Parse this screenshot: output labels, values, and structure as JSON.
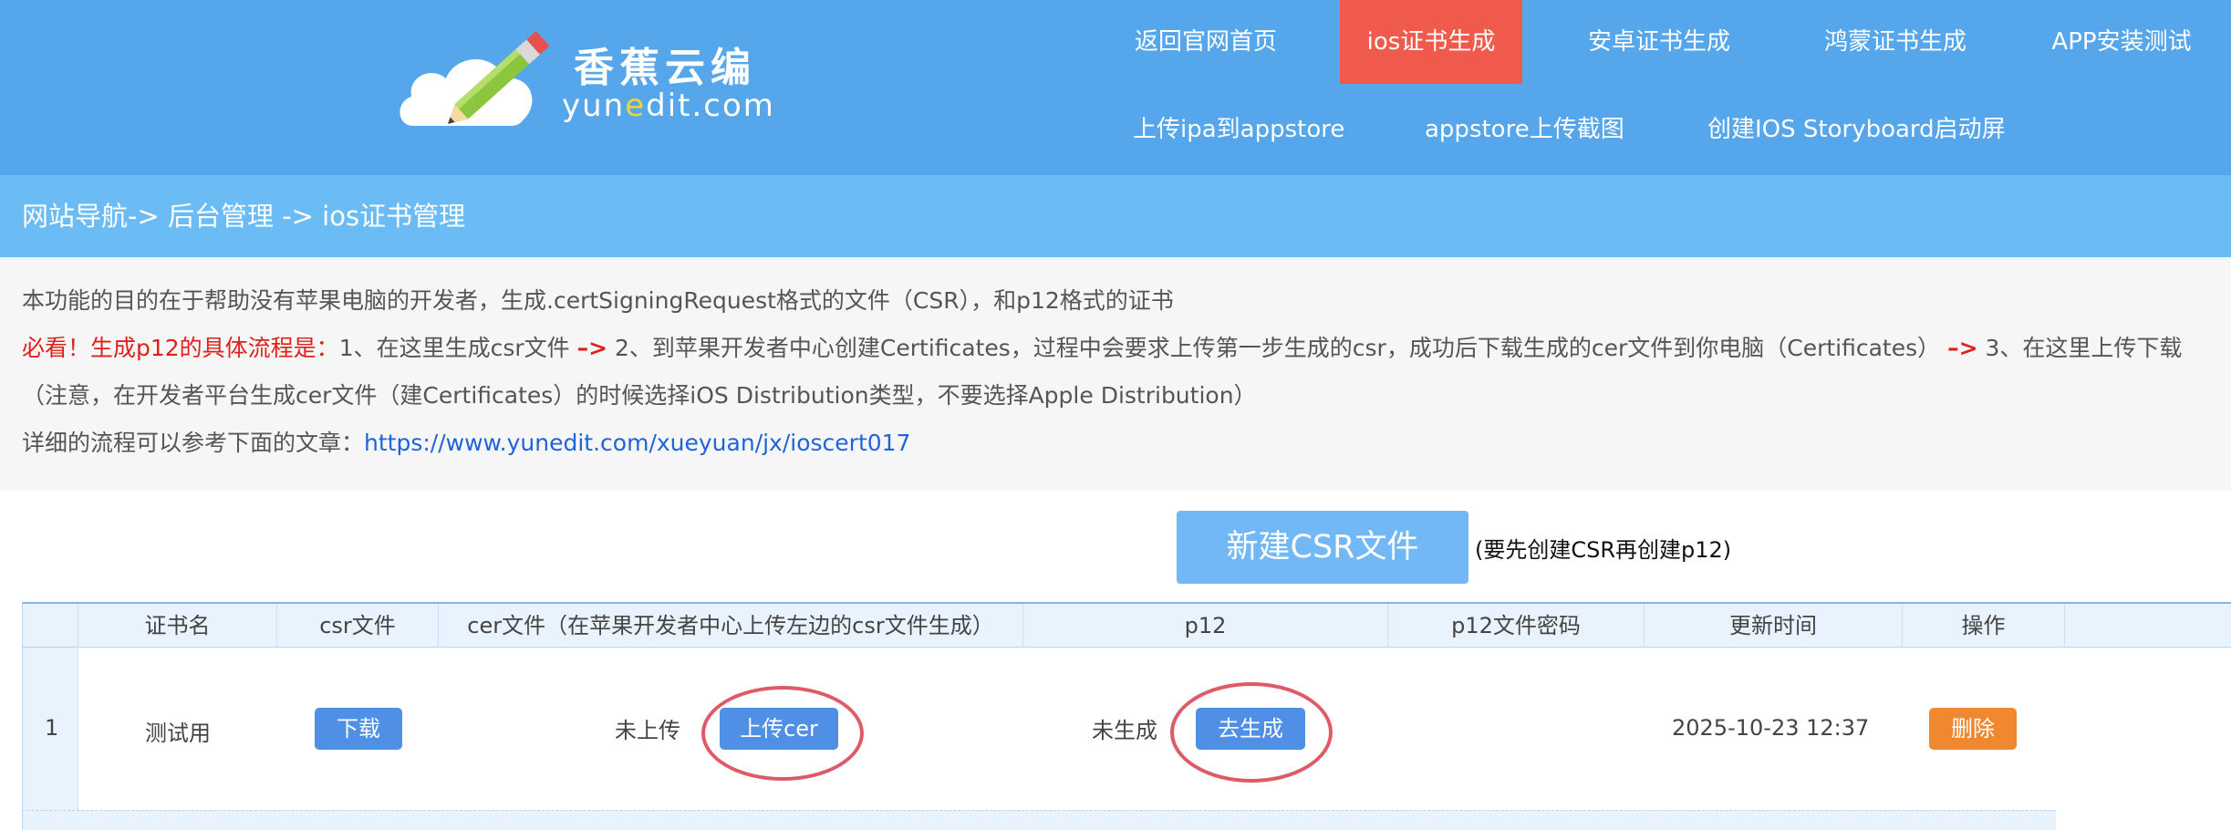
{
  "brand": {
    "name_cn": "香蕉云编",
    "name_en_pre": "yun",
    "name_en_e": "e",
    "name_en_post": "dit.com"
  },
  "nav": {
    "items": [
      {
        "label": "返回官网首页",
        "active": false
      },
      {
        "label": "ios证书生成",
        "active": true
      },
      {
        "label": "安卓证书生成",
        "active": false
      },
      {
        "label": "鸿蒙证书生成",
        "active": false
      },
      {
        "label": "APP安装测试",
        "active": false
      },
      {
        "label": "上传ipa到appstore",
        "active": false
      },
      {
        "label": "appstore上传截图",
        "active": false
      },
      {
        "label": "创建IOS Storyboard启动屏",
        "active": false
      }
    ]
  },
  "breadcrumb": "网站导航-> 后台管理 -> ios证书管理",
  "info": {
    "line1": "本功能的目的在于帮助没有苹果电脑的开发者，生成.certSigningRequest格式的文件（CSR），和p12格式的证书",
    "line2_red": "必看！生成p12的具体流程是：",
    "line2_step1": "1、在这里生成csr文件 ",
    "arrow": "–>",
    "line2_step2": " 2、到苹果开发者中心创建Certificates，过程中会要求上传第一步生成的csr，成功后下载生成的cer文件到你电脑（Certificates） ",
    "line2_step3": " 3、在这里上传下载",
    "line3": "（注意，在开发者平台生成cer文件（建Certificates）的时候选择iOS Distribution类型，不要选择Apple Distribution）",
    "line4_prefix": "详细的流程可以参考下面的文章：",
    "line4_link": "https://www.yunedit.com/xueyuan/jx/ioscert017"
  },
  "actions": {
    "new_csr": "新建CSR文件",
    "new_csr_hint": "(要先创建CSR再创建p12)"
  },
  "table": {
    "headers": [
      "",
      "证书名",
      "csr文件",
      "cer文件（在苹果开发者中心上传左边的csr文件生成）",
      "p12",
      "p12文件密码",
      "更新时间",
      "操作"
    ],
    "rows": [
      {
        "index": "1",
        "name": "测试用",
        "csr_button": "下载",
        "cer_status": "未上传",
        "cer_button": "上传cer",
        "p12_status": "未生成",
        "p12_button": "去生成",
        "p12_password": "",
        "updated": "2025-10-23 12:37",
        "delete_button": "删除"
      }
    ]
  },
  "colors": {
    "header_bg": "#55a6ea",
    "active_nav": "#ef5a4c",
    "breadcrumb_bg": "#6bbcf5",
    "primary_button": "#4f8fe5",
    "danger_button": "#f08830",
    "highlight_circle": "#de5a66"
  }
}
